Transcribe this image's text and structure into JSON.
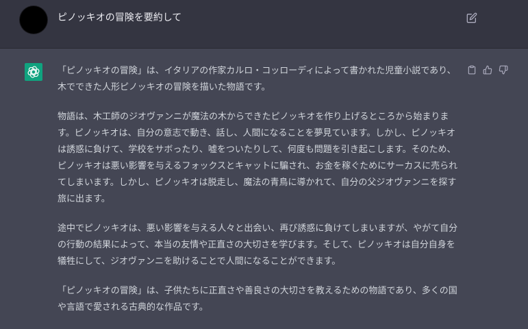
{
  "user_message": {
    "text": "ピノッキオの冒険を要約して"
  },
  "assistant_message": {
    "paragraphs": [
      "「ピノッキオの冒険」は、イタリアの作家カルロ・コッローディによって書かれた児童小説であり、木でできた人形ピノッキオの冒険を描いた物語です。",
      "物語は、木工師のジオヴァンニが魔法の木からできたピノッキオを作り上げるところから始まります。ピノッキオは、自分の意志で動き、話し、人間になることを夢見ています。しかし、ピノッキオは誘惑に負けて、学校をサボったり、嘘をついたりして、何度も問題を引き起こします。そのため、ピノッキオは悪い影響を与えるフォックスとキャットに騙され、お金を稼ぐためにサーカスに売られてしまいます。しかし、ピノッキオは脱走し、魔法の青鳥に導かれて、自分の父ジオヴァンニを探す旅に出ます。",
      "途中でピノッキオは、悪い影響を与える人々と出会い、再び誘惑に負けてしまいますが、やがて自分の行動の結果によって、本当の友情や正直さの大切さを学びます。そして、ピノッキオは自分自身を犠牲にして、ジオヴァンニを助けることで人間になることができます。",
      "「ピノッキオの冒険」は、子供たちに正直さや善良さの大切さを教えるための物語であり、多くの国や言語で愛される古典的な作品です。"
    ]
  },
  "icons": {
    "user_avatar": "user-avatar",
    "edit": "edit-icon",
    "bot_avatar": "openai-logo-icon",
    "copy": "clipboard-icon",
    "thumbs_up": "thumbs-up-icon",
    "thumbs_down": "thumbs-down-icon"
  },
  "colors": {
    "user_row_bg": "#343541",
    "assistant_row_bg": "#444654",
    "bot_avatar_bg": "#10a37f",
    "text": "#d1d5db",
    "icon": "#acacbe"
  }
}
